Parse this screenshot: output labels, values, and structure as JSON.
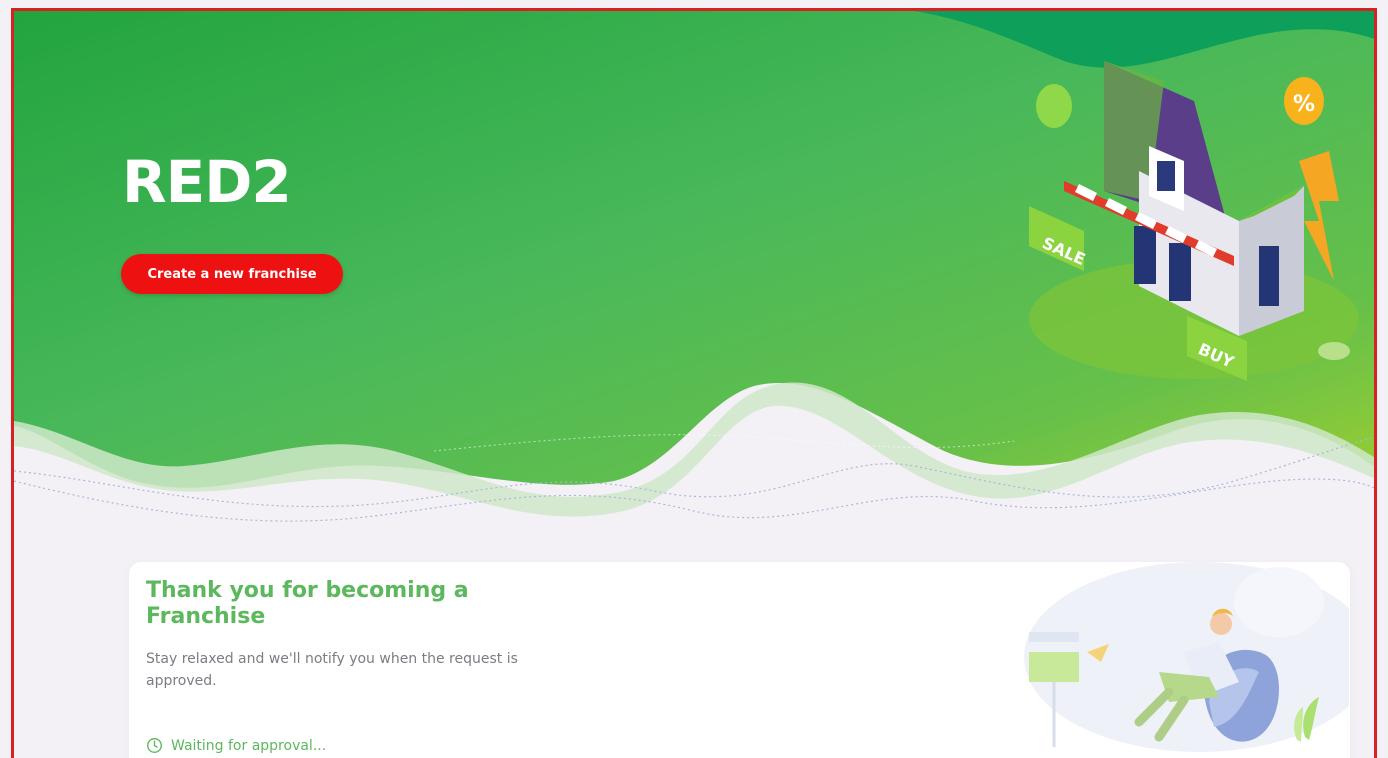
{
  "hero": {
    "title": "RED2",
    "cta_label": "Create a new franchise",
    "sign_sale": "SALE",
    "sign_buy": "BUY",
    "badge_percent": "%"
  },
  "card": {
    "title": "Thank you for becoming a Franchise",
    "subtitle": "Stay relaxed and we'll notify you when the request is approved.",
    "status_text": "Waiting for approval...",
    "status_icon": "clock-icon"
  },
  "colors": {
    "hero_green": "#3db04f",
    "accent_red": "#ee1111",
    "title_green": "#5cb85c",
    "frame_border": "#d62222"
  }
}
